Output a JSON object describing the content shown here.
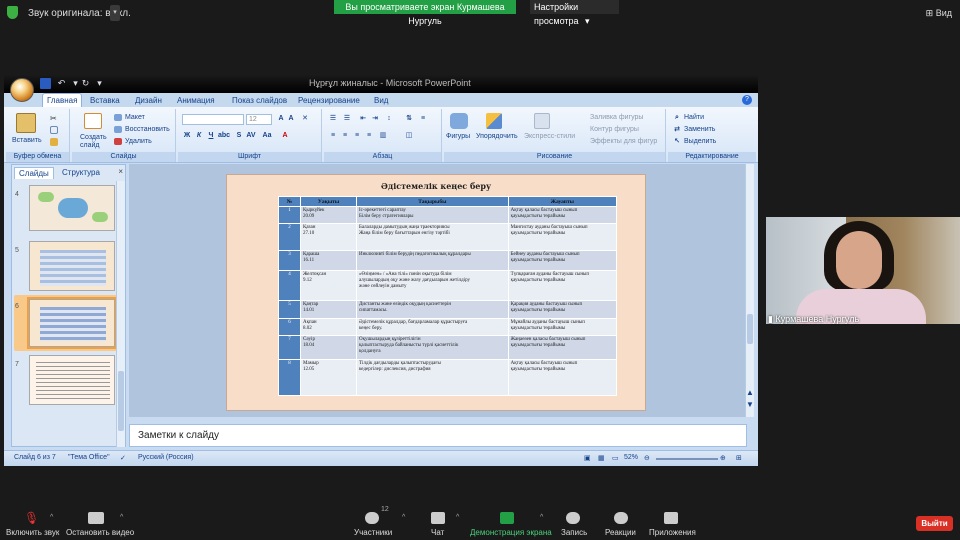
{
  "zoom": {
    "original_sound": "Звук оригинала: выкл.",
    "banner": "Вы просматриваете экран Курмашева Нургуль",
    "view_settings": "Настройки просмотра",
    "view_settings_caret": "▾",
    "view_button": "Вид",
    "participant_name": "Курмашева Нургуль",
    "participants_count": "12",
    "toolbar": {
      "unmute": "Включить звук",
      "start_video": "Остановить видео",
      "participants": "Участники",
      "chat": "Чат",
      "share_screen": "Демонстрация экрана",
      "record": "Запись",
      "reactions": "Реакции",
      "apps": "Приложения",
      "exit": "Выйти"
    },
    "colors": {
      "banner": "#23a046",
      "exit": "#d93025",
      "share": "#23a046"
    }
  },
  "powerpoint": {
    "title": "Нұрғұл жиналыс - Microsoft PowerPoint",
    "tabs": [
      "Главная",
      "Вставка",
      "Дизайн",
      "Анимация",
      "Показ слайдов",
      "Рецензирование",
      "Вид"
    ],
    "ribbon": {
      "clipboard": {
        "label": "Буфер обмена",
        "paste": "Вставить"
      },
      "slides": {
        "label": "Слайды",
        "new_slide": "Создать слайд",
        "layout": "Макет",
        "reset": "Восстановить",
        "delete": "Удалить"
      },
      "font": {
        "label": "Шрифт",
        "size": "12"
      },
      "paragraph": {
        "label": "Абзац"
      },
      "drawing": {
        "label": "Рисование",
        "shapes": "Фигуры",
        "arrange": "Упорядочить",
        "quick_styles": "Экспресс-стили",
        "fill": "Заливка фигуры",
        "outline": "Контур фигуры",
        "effects": "Эффекты для фигур"
      },
      "editing": {
        "label": "Редактирование",
        "find": "Найти",
        "replace": "Заменить",
        "select": "Выделить"
      }
    },
    "left_pane": {
      "tab_slides": "Слайды",
      "tab_outline": "Структура",
      "close": "×",
      "thumb_numbers": [
        "4",
        "5",
        "6",
        "7"
      ]
    },
    "slide": {
      "title": "Әдістемелік кеңес беру",
      "headers": [
        "№",
        "Уақыты",
        "Тақырыбы",
        "Жауапты"
      ],
      "rows": [
        [
          "1",
          "Қыркүйек\n20.09",
          "Іс-әрекеттегі сараптау\nБілім беру стратегиялары",
          "Ақтау қаласы бастауыш сынып\nқауымдастығы  төрайымы"
        ],
        [
          "2",
          "Қазан\n27.10",
          "Балаларды дамытудың жаңа траекториясы\nЖаңа білім беру бағыттарын енгізу тәртібі",
          "Мангистау  ауданы  бастауыш  сынып\nқауымдастығы  төрайымы"
        ],
        [
          "3",
          "Қараша\n16.11",
          "Инклюзивті білім берудің педагогикалық құралдары",
          "Бейнеу ауданы бастауыш сынып\nқауымдастығы  төрайымы"
        ],
        [
          "4",
          "Желтоқсан\n9.12",
          "«Өзіңмен» / «Ана тілі» пәнін оқытуда білім\nалушылардың оқу және жазу дағдыларын жетілдіру\nжәне сөйлеуін дамыту",
          "Түпқараған  ауданы бастауыш сынып\nқауымдастығы  төрайымы"
        ],
        [
          "5",
          "Қаңтар\n14.01",
          "Дистанты және өзіндік оқудың қасиеттерін\nсипаттамасы.",
          "Қарақия  ауданы бастауыш сынып\nқауымдастығы  төрайымы"
        ],
        [
          "6",
          "Ақпан\n8.02",
          "Әдістемелік құралдар, бағдарламалар құрастыруға\nкеңес беру.",
          "Мұнайлы ауданы бастауыш сынып\nқауымдастығы  төрайымы"
        ],
        [
          "7",
          "Сәуір\n18.04",
          " Оқушылардың құзіреттілігін\nқалыптастыруда байланысты түрлі қасиеттілік\nқолдануға",
          "Жаңаөзен қаласы бастауыш сынып\nқауымдастығы  төрайымы"
        ],
        [
          "8",
          "Мамыр\n12.05",
          "Тілдік дағдыларды қалыптастырудағы\nкедергілер: дислексия, дисграфия",
          "Ақтау қаласы бастауыш сынып\nқауымдастығы  төрайымы"
        ]
      ]
    },
    "notes_placeholder": "Заметки к слайду",
    "status": {
      "slide_counter": "Слайд 6 из 7",
      "theme": "\"Тема Office\"",
      "language": "Русский (Россия)",
      "zoom": "52%"
    }
  }
}
